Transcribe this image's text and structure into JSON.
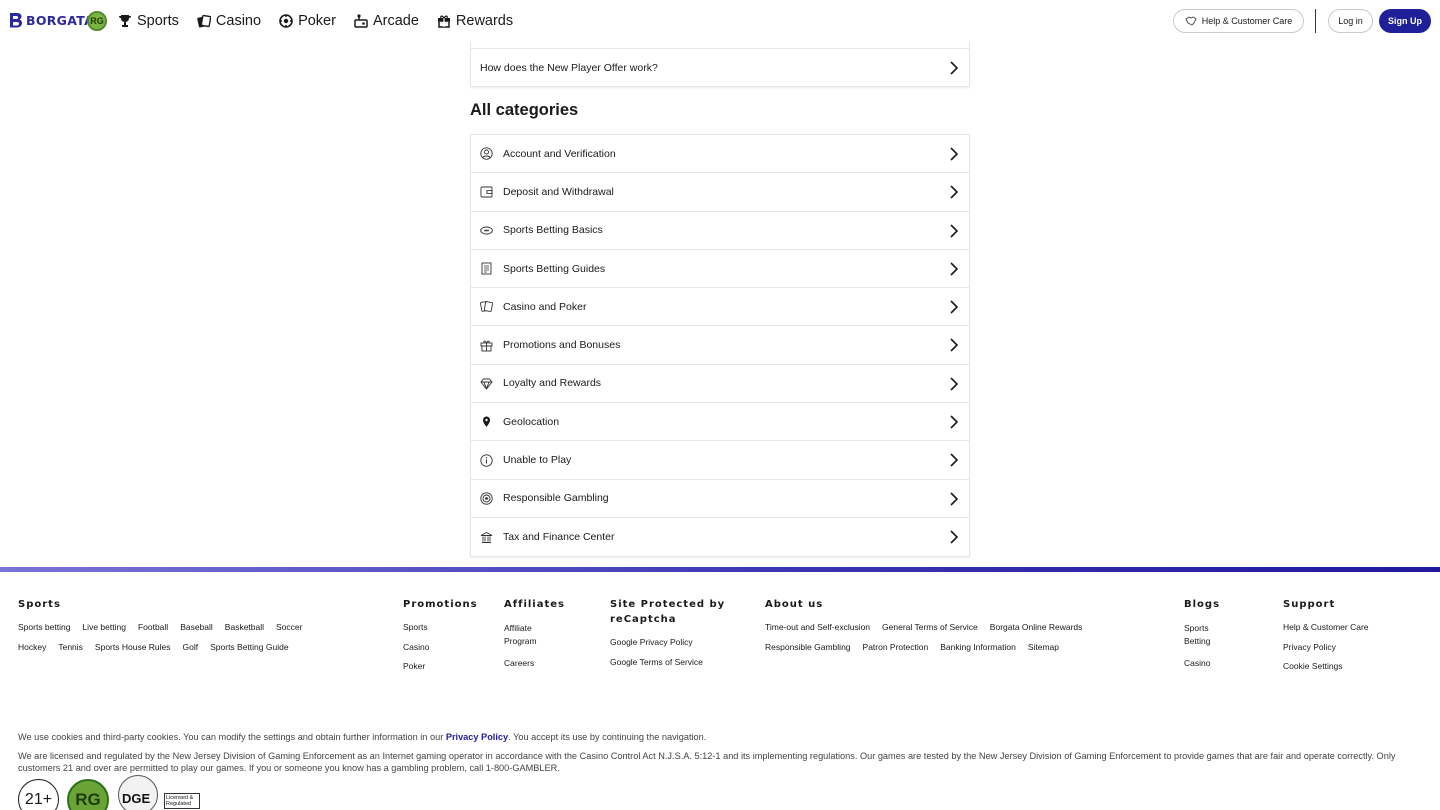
{
  "header": {
    "logo_text": "BORGATA",
    "rg_badge": "RG",
    "nav": [
      {
        "label": "Sports",
        "icon": "trophy-icon"
      },
      {
        "label": "Casino",
        "icon": "cards-icon"
      },
      {
        "label": "Poker",
        "icon": "poker-chip-icon"
      },
      {
        "label": "Arcade",
        "icon": "arcade-icon"
      },
      {
        "label": "Rewards",
        "icon": "gift-icon"
      }
    ],
    "help_label": "Help & Customer Care",
    "login_label": "Log in",
    "signup_label": "Sign Up"
  },
  "featured_question": "How does the New Player Offer work?",
  "categories_title": "All categories",
  "categories": [
    {
      "label": "Account and Verification",
      "icon": "user-circle-icon"
    },
    {
      "label": "Deposit and Withdrawal",
      "icon": "wallet-icon"
    },
    {
      "label": "Sports Betting Basics",
      "icon": "football-icon"
    },
    {
      "label": "Sports Betting Guides",
      "icon": "document-icon"
    },
    {
      "label": "Casino and Poker",
      "icon": "cards-icon"
    },
    {
      "label": "Promotions and Bonuses",
      "icon": "gift-icon"
    },
    {
      "label": "Loyalty and Rewards",
      "icon": "diamond-icon"
    },
    {
      "label": "Geolocation",
      "icon": "location-pin-icon"
    },
    {
      "label": "Unable to Play",
      "icon": "info-icon"
    },
    {
      "label": "Responsible Gambling",
      "icon": "shield-icon"
    },
    {
      "label": "Tax and Finance Center",
      "icon": "bank-icon"
    }
  ],
  "footer": {
    "sports": {
      "title": "Sports",
      "links": [
        "Sports betting",
        "Live betting",
        "Football",
        "Baseball",
        "Basketball",
        "Soccer",
        "Hockey",
        "Tennis",
        "Sports House Rules",
        "Golf",
        "Sports Betting Guide"
      ]
    },
    "promotions": {
      "title": "Promotions",
      "links": [
        "Sports",
        "Casino",
        "Poker"
      ]
    },
    "affiliates": {
      "title": "Affiliates",
      "links": [
        "Affiliate Program",
        "Careers"
      ]
    },
    "recaptcha": {
      "title": "Site Protected by reCaptcha",
      "links": [
        "Google Privacy Policy",
        "Google Terms of Service"
      ]
    },
    "about": {
      "title": "About us",
      "links": [
        "Time-out and Self-exclusion",
        "General Terms of Service",
        "Borgata Online Rewards",
        "Responsible Gambling",
        "Patron Protection",
        "Banking Information",
        "Sitemap"
      ]
    },
    "blogs": {
      "title": "Blogs",
      "links": [
        "Sports Betting",
        "Casino"
      ]
    },
    "support": {
      "title": "Support",
      "links": [
        "Help & Customer Care",
        "Privacy Policy",
        "Cookie Settings"
      ]
    }
  },
  "cookie": {
    "before": "We use cookies and third-party cookies. You can modify the settings and obtain further information in our ",
    "link": "Privacy Policy",
    "after": ". You accept its use by continuing the navigation."
  },
  "legal": "We are licensed and regulated by the New Jersey Division of Gaming Enforcement as an Internet gaming operator in accordance with the Casino Control Act N.J.S.A. 5:12-1 and its implementing regulations. Our games are tested by the New Jersey Division of Gaming Enforcement to provide games that are fair and operate correctly. Only customers 21 and over are permitted to play our games. If you or someone you know has a gambling problem, call 1-800-GAMBLER.",
  "badges": {
    "age": "21+",
    "rg": "RG",
    "dge": "DGE",
    "dge_sub": "Licensed & Regulated"
  }
}
